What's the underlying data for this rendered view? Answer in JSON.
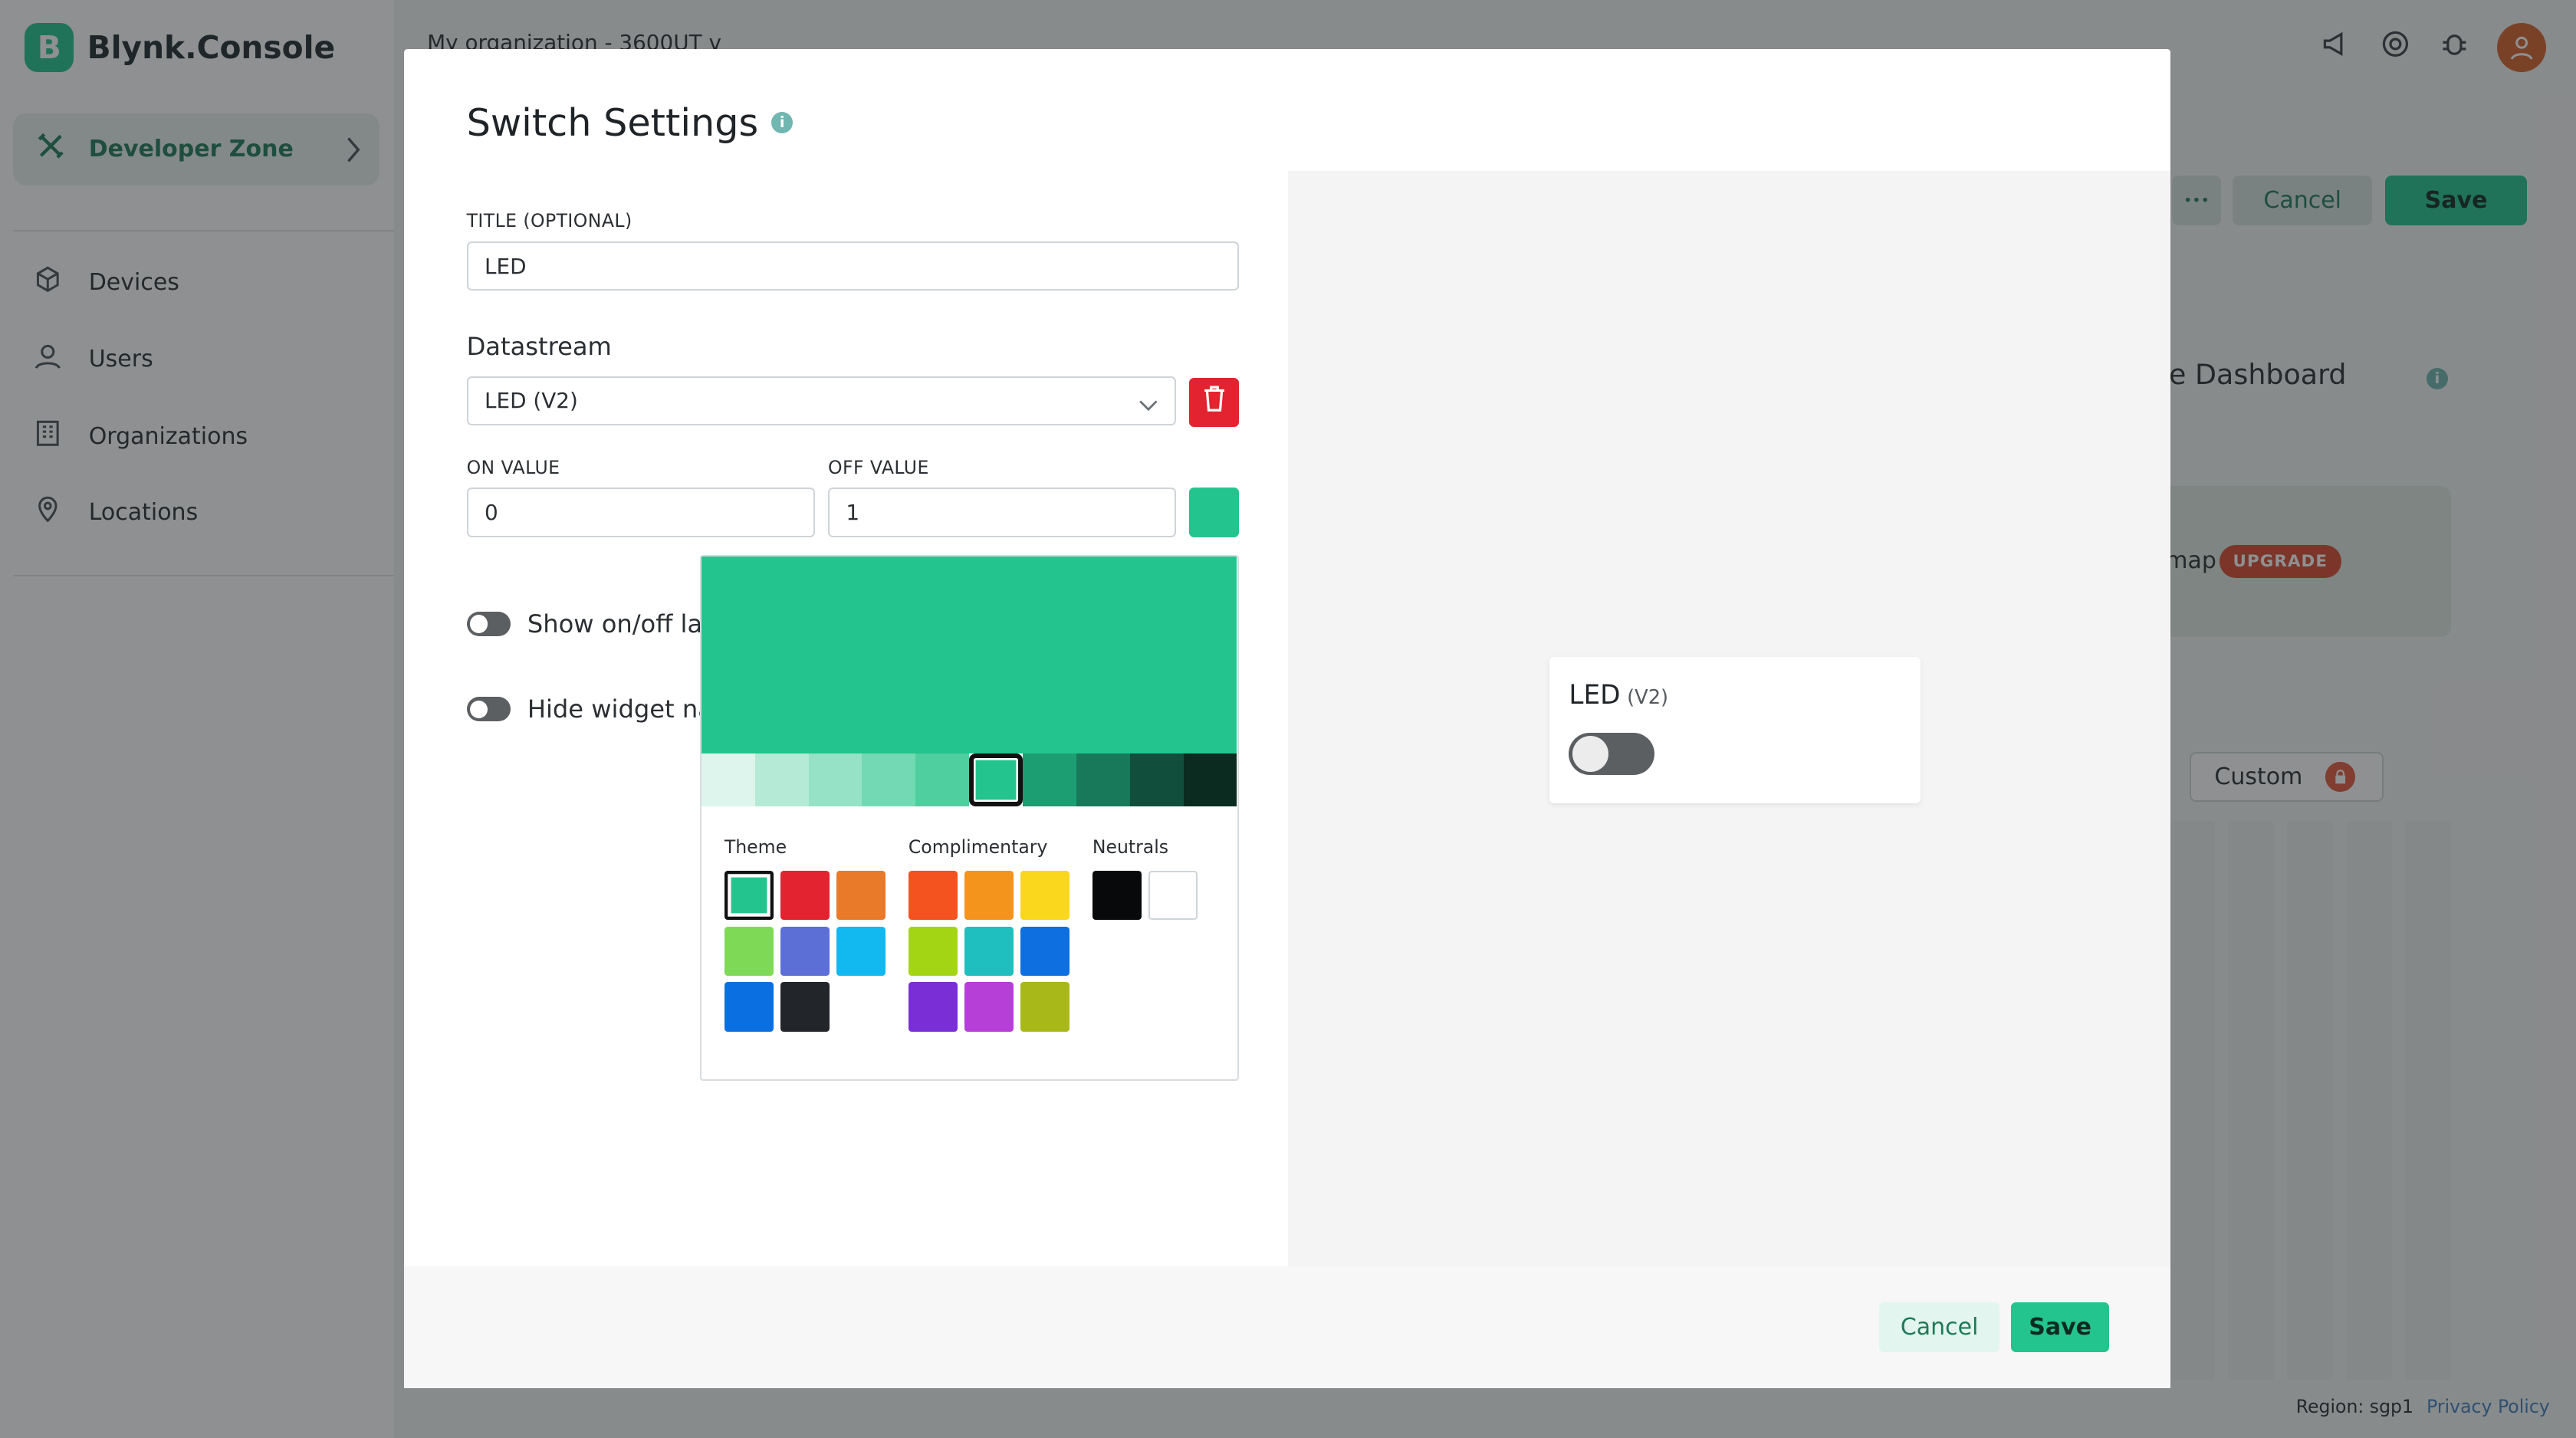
{
  "app": {
    "brand_letter": "B",
    "brand_name": "Blynk.Console",
    "org_selector": "My organization - 3600UT",
    "org_chevron": "v"
  },
  "sidebar": {
    "dev_zone_label": "Developer Zone",
    "items": [
      {
        "label": "Devices",
        "icon": "cube-icon"
      },
      {
        "label": "Users",
        "icon": "user-icon"
      },
      {
        "label": "Organizations",
        "icon": "building-icon"
      },
      {
        "label": "Locations",
        "icon": "pin-icon"
      }
    ]
  },
  "background": {
    "cancel_label": "Cancel",
    "save_label": "Save",
    "more_label": "•••",
    "mobile_dashboard_title": "bile Dashboard",
    "map_label": "map",
    "upgrade_badge": "UPGRADE",
    "custom_label": "Custom",
    "footer_region": "Region: sgp1",
    "footer_privacy": "Privacy Policy"
  },
  "modal": {
    "title": "Switch Settings",
    "info_glyph": "i",
    "title_field_label": "TITLE (OPTIONAL)",
    "title_value": "LED",
    "datastream_section": "Datastream",
    "datastream_value": "LED (V2)",
    "on_value_label": "ON VALUE",
    "on_value": "0",
    "off_value_label": "OFF VALUE",
    "off_value": "1",
    "toggle1_label": "Show on/off lab",
    "toggle2_label": "Hide widget nar",
    "cancel_label": "Cancel",
    "save_label": "Save"
  },
  "preview_widget": {
    "title": "LED",
    "datastream": "(V2)",
    "switch_state": "off"
  },
  "color_picker": {
    "selected_color": "#23C48E",
    "shades": [
      "#DDF5EC",
      "#B4EAD6",
      "#96E2C6",
      "#73D9B4",
      "#4FCE9F",
      "#23C48E",
      "#1C9E72",
      "#17785A",
      "#114E3B",
      "#0B2A20"
    ],
    "selected_shade_index": 5,
    "theme_label": "Theme",
    "theme_colors": [
      "#23C48E",
      "#E3232F",
      "#E87A2A",
      "#7ED957",
      "#5B6FD6",
      "#12B8F0",
      "#0A6FE0",
      "#22252A"
    ],
    "complimentary_label": "Complimentary",
    "complimentary_colors": [
      "#F4521E",
      "#F5941D",
      "#FAD71C",
      "#A3D514",
      "#1FBFBF",
      "#0D6FE0",
      "#7A2FD6",
      "#B63FD8",
      "#A8B819"
    ],
    "neutrals_label": "Neutrals",
    "neutral_colors": [
      "#08090B",
      "#FFFFFF"
    ]
  }
}
